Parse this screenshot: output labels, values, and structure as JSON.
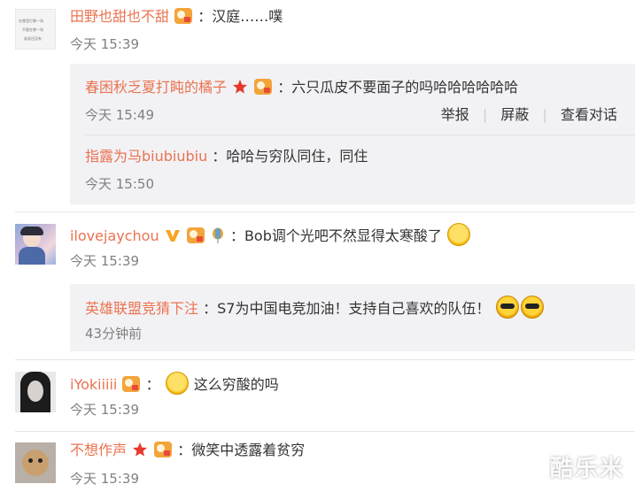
{
  "comments": [
    {
      "user": "田野也甜也不甜",
      "text": "：汉庭……噗",
      "time": "今天 15:39",
      "replies": [
        {
          "user": "春困秋乏夏打盹的橘子",
          "text": "：六只瓜皮不要面子的吗哈哈哈哈哈哈",
          "time": "今天 15:49"
        },
        {
          "user": "指露为马biubiubiu",
          "text": "：哈哈与穷队同住，同住",
          "time": "今天 15:50"
        }
      ]
    },
    {
      "user": "ilovejaychou",
      "text": "：Bob调个光吧不然显得太寒酸了",
      "time": "今天 15:39",
      "replies": [
        {
          "user": "英雄联盟竞猜下注",
          "text": "：S7为中国电竞加油！支持自己喜欢的队伍！",
          "time": "43分钟前"
        }
      ]
    },
    {
      "user": "iYokiiiii",
      "text": "这么穷酸的吗",
      "text_prefix": "：",
      "time": "今天 15:39"
    },
    {
      "user": "不想作声",
      "text": "：微笑中透露着贫穷",
      "time": "今天 15:39"
    }
  ],
  "actions": {
    "report": "举报",
    "block": "屏蔽",
    "view_conversation": "查看对话"
  },
  "avatar_note_lines": [
    "在哪里打哪一场",
    "不要在哪一场",
    "谁说还没有"
  ],
  "watermark": "酷乐米",
  "colors": {
    "username": "#eb7350",
    "time": "#808080",
    "reply_bg": "#f2f2f5",
    "badge_vip": "#f3a43b"
  },
  "icons": [
    "vip-badge-icon",
    "star-badge-icon",
    "v-badge-icon",
    "balloon-badge-icon",
    "crying-laugh-emoji-icon",
    "sunglasses-emoji-icon"
  ]
}
